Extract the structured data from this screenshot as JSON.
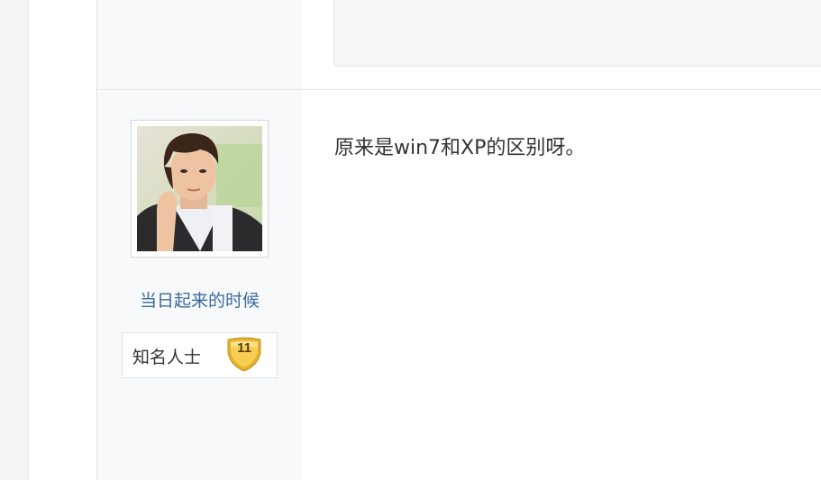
{
  "post": {
    "author": {
      "username": "当日起来的时候",
      "rank_title": "知名人士",
      "level": "11"
    },
    "content": "原来是win7和XP的区别呀。"
  },
  "colors": {
    "username_link": "#3a6a9e",
    "badge_gold": "#f2c233",
    "sidebar_bg": "#f8f9fb"
  }
}
